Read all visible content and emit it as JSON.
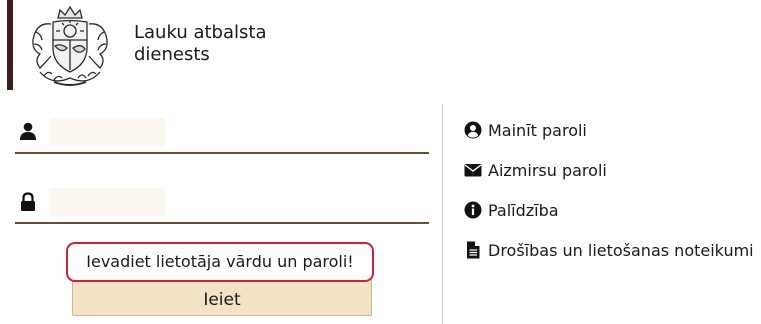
{
  "header": {
    "org_name_line1": "Lauku atbalsta",
    "org_name_line2": "dienests"
  },
  "login": {
    "username_value": "",
    "password_value": "",
    "submit_label": "Ieiet",
    "alert_message": "Ievadiet lietotāja vārdu un paroli!"
  },
  "side_links": [
    {
      "label": "Mainīt paroli",
      "icon": "user-circle-icon"
    },
    {
      "label": "Aizmirsu paroli",
      "icon": "envelope-icon"
    },
    {
      "label": "Palīdzība",
      "icon": "info-circle-icon"
    },
    {
      "label": "Drošības un lietošanas noteikumi",
      "icon": "document-icon"
    }
  ],
  "colors": {
    "brand": "#3a2018",
    "field_underline": "#6a4e2e",
    "button_bg": "#f3e2c4",
    "alert_border": "#d0213c"
  }
}
